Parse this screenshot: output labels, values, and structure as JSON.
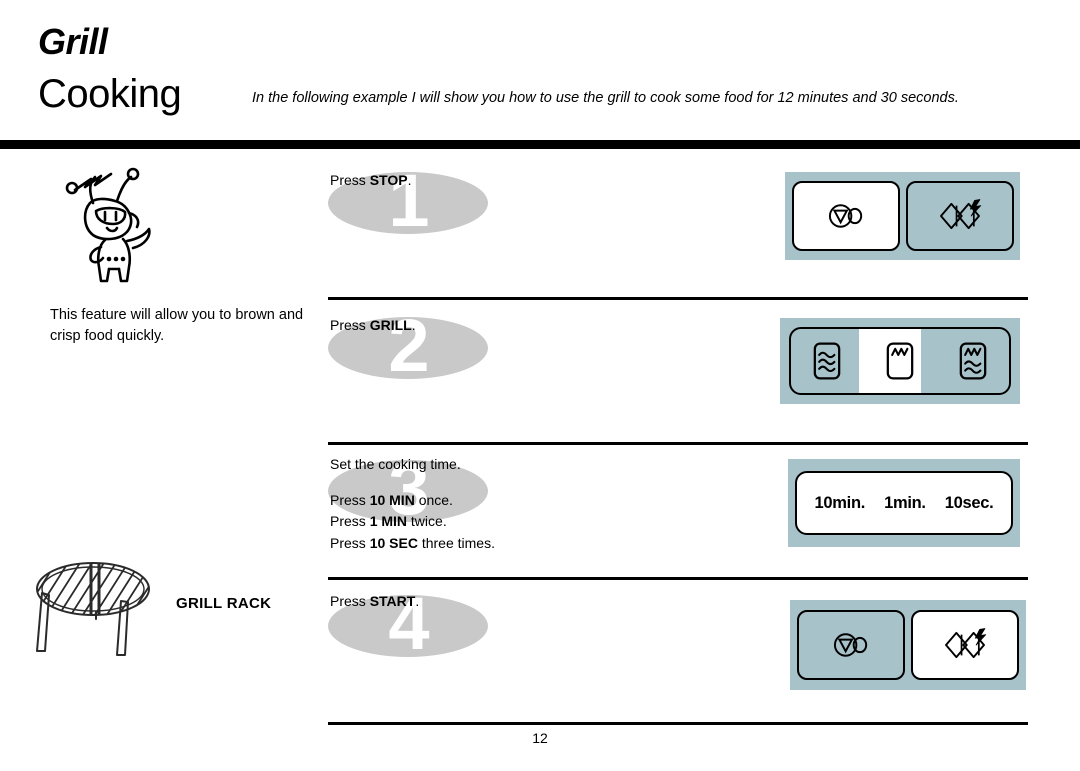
{
  "header": {
    "title_line1": "Grill",
    "title_line2": "Cooking",
    "description": "In the following example I will show you how to use the grill to cook some food for 12 minutes and 30 seconds."
  },
  "sidebar": {
    "mascot_icon": "mascot-character-icon",
    "feature_note": "This feature will allow you to brown and crisp food quickly.",
    "rack_icon": "grill-rack-icon",
    "rack_label": "GRILL RACK"
  },
  "steps": [
    {
      "numeral": "1",
      "instruction_prefix": "Press ",
      "instruction_key": "STOP",
      "instruction_suffix": ".",
      "panel": {
        "keys": [
          {
            "icon": "stop-clear-icon",
            "active": true
          },
          {
            "icon": "start-quick-icon",
            "active": false
          }
        ]
      }
    },
    {
      "numeral": "2",
      "instruction_prefix": "Press ",
      "instruction_key": "GRILL",
      "instruction_suffix": ".",
      "panel": {
        "modes": [
          {
            "icon": "microwave-waves-icon",
            "active": false
          },
          {
            "icon": "grill-element-icon",
            "active": true
          },
          {
            "icon": "combi-grill-microwave-icon",
            "active": false
          }
        ]
      }
    },
    {
      "numeral": "3",
      "lines": [
        {
          "prefix": "Set the cooking time.",
          "key": "",
          "suffix": ""
        },
        {
          "prefix": "Press ",
          "key": "10 MIN",
          "suffix": " once."
        },
        {
          "prefix": "Press ",
          "key": "1 MIN",
          "suffix": " twice."
        },
        {
          "prefix": "Press ",
          "key": "10 SEC",
          "suffix": " three times."
        }
      ],
      "panel": {
        "display": [
          "10min.",
          "1min.",
          "10sec."
        ]
      }
    },
    {
      "numeral": "4",
      "instruction_prefix": "Press ",
      "instruction_key": "START",
      "instruction_suffix": ".",
      "panel": {
        "keys": [
          {
            "icon": "stop-clear-icon",
            "active": false
          },
          {
            "icon": "start-quick-icon",
            "active": true
          }
        ]
      }
    }
  ],
  "footer": {
    "page_number": "12"
  },
  "colors": {
    "panel_bg": "#a8c2ca",
    "numeral_ellipse": "#c9c9c9",
    "rule": "#000000"
  }
}
